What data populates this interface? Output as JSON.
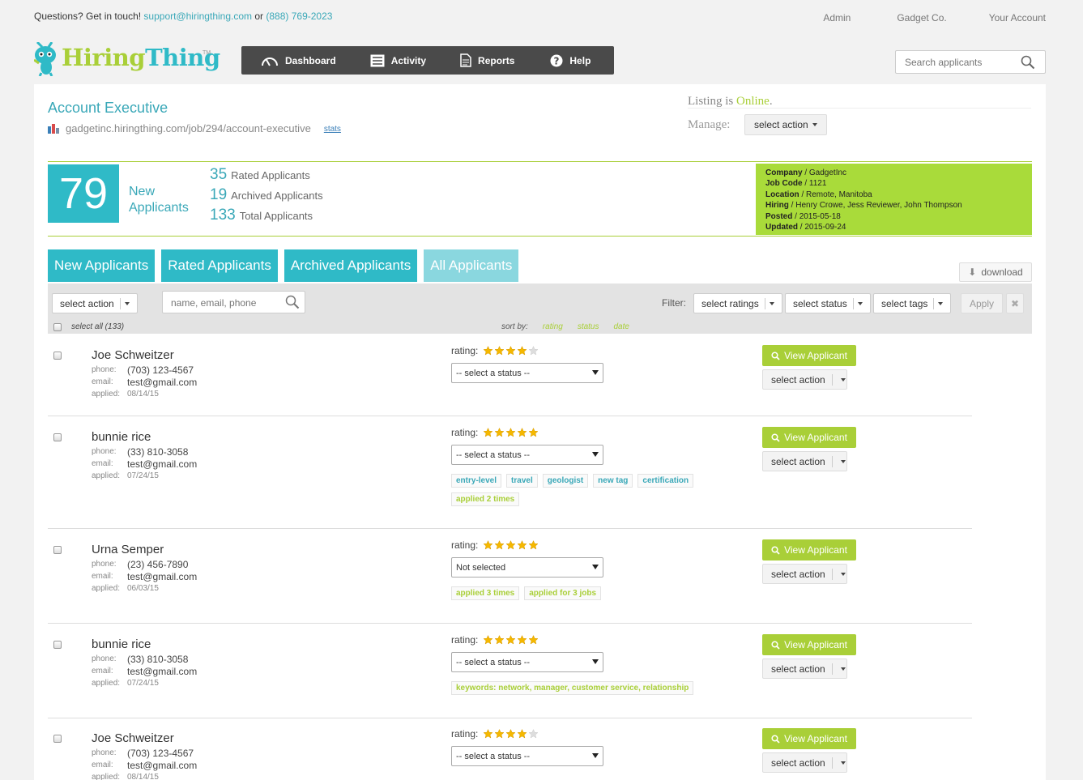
{
  "topbar": {
    "question": "Questions? Get in touch!",
    "email": "support@hiringthing.com",
    "or": "or",
    "phone": "(888) 769-2023",
    "links": [
      "Admin",
      "Gadget Co.",
      "Your Account"
    ]
  },
  "logo": {
    "hiring": "Hiring",
    "thing": "Thing",
    "tm": "TM"
  },
  "nav": {
    "dashboard": "Dashboard",
    "activity": "Activity",
    "reports": "Reports",
    "help": "Help"
  },
  "search": {
    "placeholder": "Search applicants"
  },
  "job": {
    "title": "Account Executive",
    "url": "gadgetinc.hiringthing.com/job/294/account-executive",
    "stats": "stats"
  },
  "listing": {
    "prefix": "Listing is",
    "status": "Online",
    "suffix": ".",
    "manage_label": "Manage:",
    "manage_action": "select action"
  },
  "summary": {
    "new_count": "79",
    "new_label_1": "New",
    "new_label_2": "Applicants",
    "rated_count": "35",
    "rated_label": "Rated Applicants",
    "archived_count": "19",
    "archived_label": "Archived Applicants",
    "total_count": "133",
    "total_label": "Total Applicants"
  },
  "details": [
    {
      "key": "Company",
      "value": "GadgetInc"
    },
    {
      "key": "Job Code",
      "value": "1121"
    },
    {
      "key": "Location",
      "value": "Remote, Manitoba"
    },
    {
      "key": "Hiring",
      "value": "Henry Crowe, Jess Reviewer, John Thompson"
    },
    {
      "key": "Posted",
      "value": "2015-05-18"
    },
    {
      "key": "Updated",
      "value": "2015-09-24"
    }
  ],
  "tabs": [
    "New Applicants",
    "Rated Applicants",
    "Archived Applicants",
    "All Applicants"
  ],
  "download": "download",
  "toolbar": {
    "select_action": "select action",
    "search_placeholder": "name, email, phone",
    "filter": "Filter:",
    "ratings": "select ratings",
    "status": "select status",
    "tags": "select tags",
    "apply": "Apply",
    "clear": "✖",
    "select_all": "select all (133)",
    "sort_by": "sort by:",
    "sort_options": [
      "rating",
      "status",
      "date"
    ]
  },
  "labels": {
    "phone": "phone:",
    "email": "email:",
    "applied": "applied:",
    "rating": "rating:",
    "view": "View Applicant",
    "action": "select action"
  },
  "applicants": [
    {
      "name": "Joe Schweitzer",
      "phone": "(703) 123-4567",
      "email": "test@gmail.com",
      "applied": "08/14/15",
      "rating": 4,
      "status": "-- select a status --",
      "tags": []
    },
    {
      "name": "bunnie rice",
      "phone": "(33) 810-3058",
      "email": "test@gmail.com",
      "applied": "07/24/15",
      "rating": 5,
      "status": "-- select a status --",
      "tags": [
        {
          "text": "entry-level",
          "color": "blue"
        },
        {
          "text": "travel",
          "color": "blue"
        },
        {
          "text": "geologist",
          "color": "blue"
        },
        {
          "text": "new tag",
          "color": "blue"
        },
        {
          "text": "certification",
          "color": "blue"
        },
        {
          "text": "applied 2 times",
          "color": "green"
        }
      ]
    },
    {
      "name": "Urna Semper",
      "phone": "(23) 456-7890",
      "email": "test@gmail.com",
      "applied": "06/03/15",
      "rating": 5,
      "status": "Not selected",
      "tags": [
        {
          "text": "applied 3 times",
          "color": "green"
        },
        {
          "text": "applied for 3 jobs",
          "color": "green"
        }
      ]
    },
    {
      "name": "bunnie rice",
      "phone": "(33) 810-3058",
      "email": "test@gmail.com",
      "applied": "07/24/15",
      "rating": 5,
      "status": "-- select a status --",
      "tags": [
        {
          "text": "keywords: network, manager, customer service, relationship",
          "color": "green"
        }
      ]
    },
    {
      "name": "Joe Schweitzer",
      "phone": "(703) 123-4567",
      "email": "test@gmail.com",
      "applied": "08/14/15",
      "rating": 4,
      "status": "-- select a status --",
      "tags": []
    }
  ],
  "colors": {
    "teal": "#2fbac7",
    "green": "#a9cf38",
    "nav": "#4a4a4a",
    "star": "#f5b800"
  }
}
